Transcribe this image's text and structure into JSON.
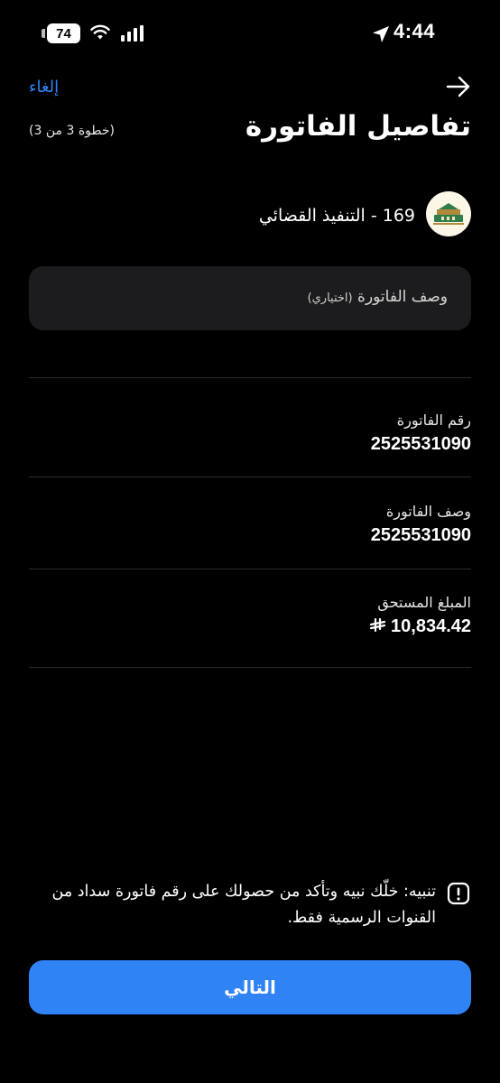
{
  "status_bar": {
    "battery": "74",
    "time": "4:44"
  },
  "header": {
    "cancel_label": "إلغاء",
    "title": "تفاصيل الفاتورة",
    "step": "(خطوة 3 من 3)"
  },
  "biller": {
    "name": "169 - التنفيذ القضائي"
  },
  "description_input": {
    "placeholder": "وصف الفاتورة",
    "optional_hint": "(اختياري)"
  },
  "fields": [
    {
      "label": "رقم الفاتورة",
      "value": "2525531090"
    },
    {
      "label": "وصف الفاتورة",
      "value": "2525531090"
    },
    {
      "label": "المبلغ المستحق",
      "value": "10,834.42",
      "currency": "SAR-symbol"
    }
  ],
  "warning": {
    "text": "تنبيه: خلّك نبيه وتأكد من حصولك على رقم فاتورة سداد من القنوات الرسمية فقط."
  },
  "next_button": {
    "label": "التالي"
  },
  "colors": {
    "accent": "#2f83f5",
    "background": "#000000",
    "input_bg": "#1c1c1e"
  }
}
